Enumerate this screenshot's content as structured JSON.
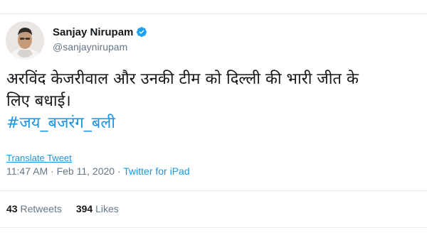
{
  "author": {
    "display_name": "Sanjay Nirupam",
    "handle": "@sanjaynirupam",
    "verified_icon": "verified-badge-icon"
  },
  "tweet": {
    "line1": "अरविंद केजरीवाल और उनकी टीम को दिल्ली की भारी जीत के",
    "line2": "लिए बधाई।",
    "hashtag": "#जय_बजरंग_बली"
  },
  "translate_label": "Translate Tweet",
  "meta": {
    "time": "11:47 AM",
    "separator": " · ",
    "date": "Feb 11, 2020",
    "source": "Twitter for iPad"
  },
  "stats": {
    "retweets_count": "43",
    "retweets_label": "Retweets",
    "likes_count": "394",
    "likes_label": "Likes"
  },
  "colors": {
    "link": "#1b95e0",
    "text": "#14171a",
    "muted": "#657786",
    "border": "#e6ecf0"
  }
}
